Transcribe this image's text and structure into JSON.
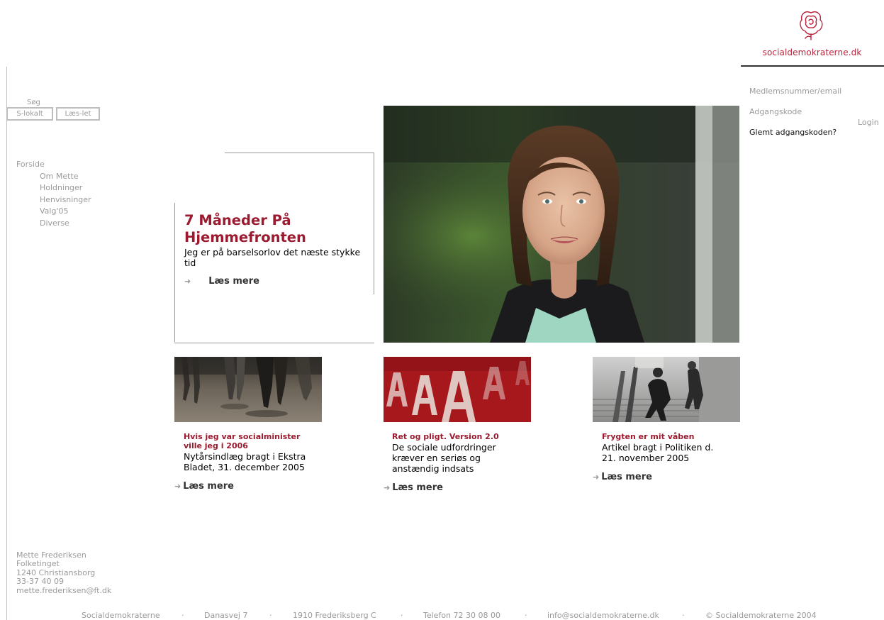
{
  "brand": {
    "name": "socialdemokraterne.dk",
    "logo_icon": "rose-icon",
    "color": "#b8233b"
  },
  "search": {
    "label": "Søg",
    "buttons": [
      "S-lokalt",
      "Læs-let"
    ]
  },
  "nav": {
    "home": "Forside",
    "items": [
      "Om Mette",
      "Holdninger",
      "Henvisninger",
      "Valg'05",
      "Diverse"
    ]
  },
  "login": {
    "member_label": "Medlemsnummer/email",
    "password_label": "Adgangskode",
    "login_button": "Login",
    "forgot": "Glemt adgangskoden?"
  },
  "feature": {
    "title": "7 Måneder På Hjemmefronten",
    "text": "Jeg er på barselsorlov det næste stykke tid",
    "more": "Læs mere"
  },
  "cards": [
    {
      "title": "Hvis jeg var socialminister ville jeg i 2006",
      "text": "Nytårsindlæg bragt i Ekstra Bladet, 31. december 2005",
      "more": "Læs mere"
    },
    {
      "title": "Ret og pligt. Version 2.0",
      "text": "De sociale udfordringer kræver en seriøs og anstændig indsats",
      "more": "Læs mere"
    },
    {
      "title": "Frygten er mit våben",
      "text": "Artikel bragt i Politiken d. 21. november 2005",
      "more": "Læs mere"
    }
  ],
  "contact": [
    "Mette Frederiksen",
    "Folketinget",
    "1240 Christiansborg",
    "33-37 40 09",
    "mette.frederiksen@ft.dk"
  ],
  "footer": {
    "items": [
      "Socialdemokraterne",
      "Danasvej 7",
      "1910 Frederiksberg C",
      "Telefon 72 30 08 00",
      "info@socialdemokraterne.dk",
      "© Socialdemokraterne 2004"
    ],
    "separator": "·"
  },
  "colors": {
    "accent": "#9b1a2f",
    "muted": "#9a9a9a",
    "rule": "#999999"
  }
}
